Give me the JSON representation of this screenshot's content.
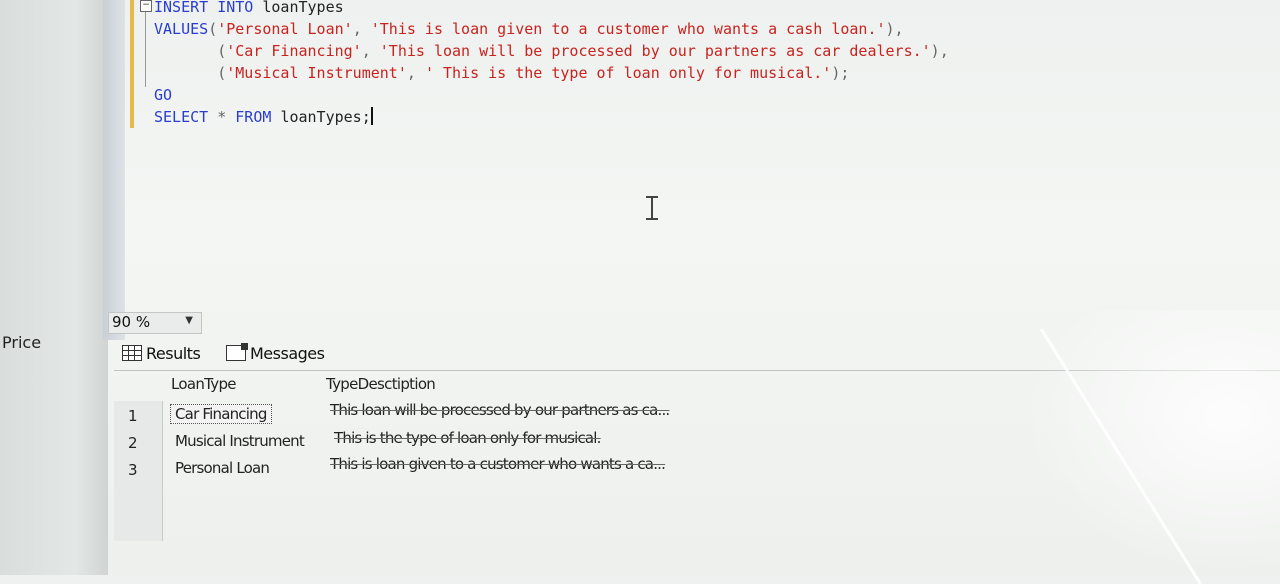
{
  "editor": {
    "lines": [
      {
        "parts": [
          [
            "kw",
            "INSERT "
          ],
          [
            "kw",
            "INTO "
          ],
          [
            "plain",
            "loanTypes"
          ]
        ]
      },
      {
        "parts": [
          [
            "kw",
            "VALUES"
          ],
          [
            "gray",
            "("
          ],
          [
            "str",
            "'Personal Loan'"
          ],
          [
            "gray",
            ", "
          ],
          [
            "str",
            "'This is loan given to a customer who wants a cash loan.'"
          ],
          [
            "gray",
            "),"
          ]
        ]
      },
      {
        "parts": [
          [
            "gray",
            "       ("
          ],
          [
            "str",
            "'Car Financing'"
          ],
          [
            "gray",
            ", "
          ],
          [
            "str",
            "'This loan will be processed by our partners as car dealers.'"
          ],
          [
            "gray",
            "),"
          ]
        ]
      },
      {
        "parts": [
          [
            "gray",
            "       ("
          ],
          [
            "str",
            "'Musical Instrument'"
          ],
          [
            "gray",
            ", "
          ],
          [
            "str",
            "' This is the type of loan only for musical.'"
          ],
          [
            "gray",
            ");"
          ]
        ]
      },
      {
        "parts": [
          [
            "kw",
            "GO"
          ]
        ]
      },
      {
        "parts": [
          [
            "kw",
            "SELECT "
          ],
          [
            "gray",
            "* "
          ],
          [
            "kw",
            "FROM "
          ],
          [
            "plain",
            "loanTypes;"
          ]
        ]
      }
    ],
    "collapse_symbol": "−"
  },
  "zoom": {
    "value": "90 %",
    "arrow": "▼"
  },
  "left_pane": {
    "label": "Price"
  },
  "results": {
    "tabs": [
      {
        "label": "Results",
        "icon": "grid-icon"
      },
      {
        "label": "Messages",
        "icon": "messages-icon"
      }
    ],
    "columns": [
      "LoanType",
      "TypeDesctiption"
    ],
    "rows": [
      {
        "num": "1",
        "loan_type": "Car Financing",
        "description": "This loan will be processed by our partners as ca..."
      },
      {
        "num": "2",
        "loan_type": "Musical Instrument",
        "description": "This is the type of loan only for musical."
      },
      {
        "num": "3",
        "loan_type": "Personal Loan",
        "description": "This is loan given to a customer who wants a ca..."
      }
    ]
  }
}
